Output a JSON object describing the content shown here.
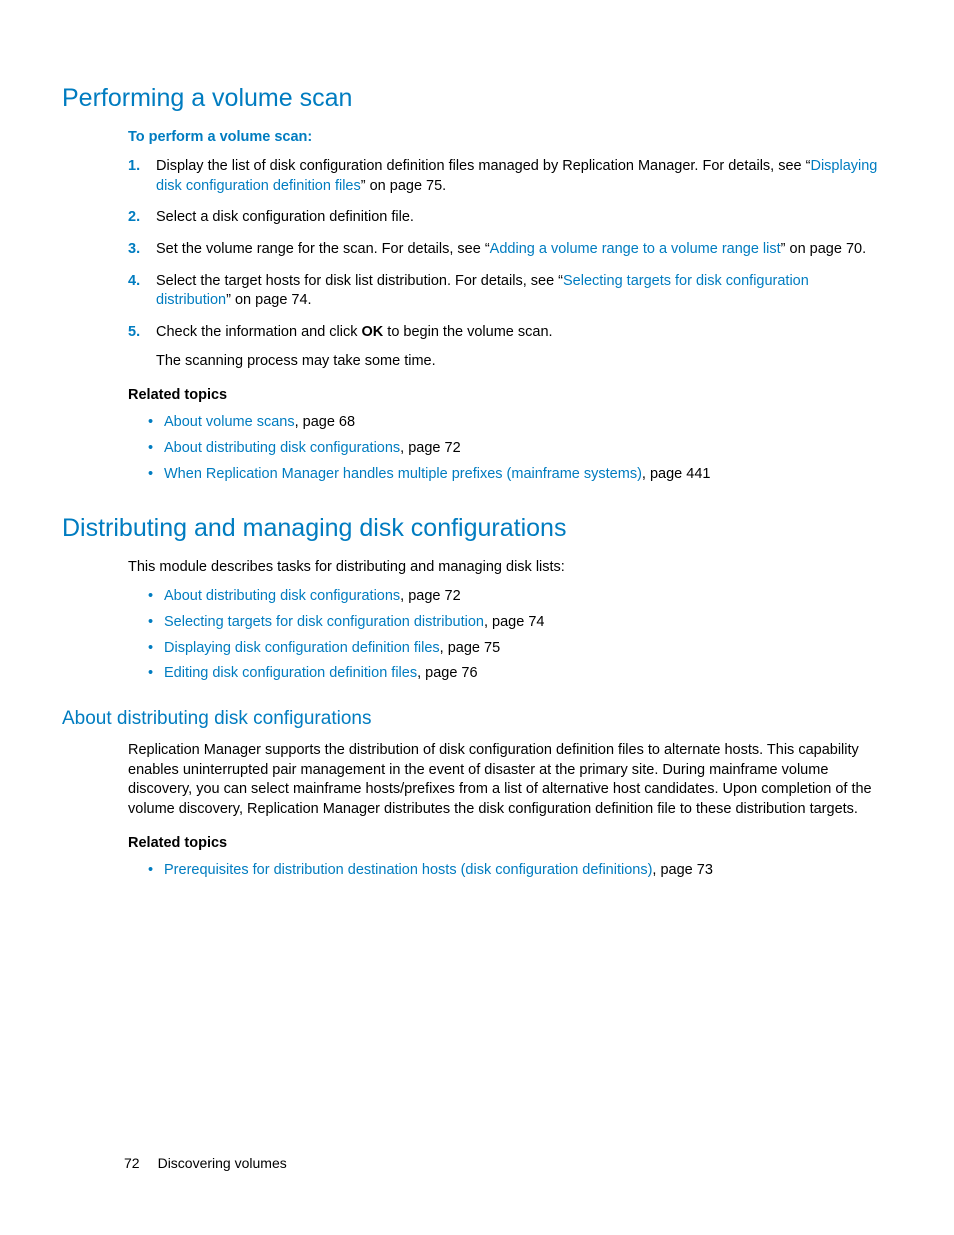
{
  "section1": {
    "title": "Performing a volume scan",
    "procedure_title": "To perform a volume scan:",
    "steps": {
      "s1a": "Display the list of disk configuration definition files managed by Replication Manager. For details, see “",
      "s1link": "Displaying disk configuration definition files",
      "s1b": "” on page 75.",
      "s2": "Select a disk configuration definition file.",
      "s3a": "Set the volume range for the scan. For details, see “",
      "s3link": "Adding a volume range to a volume range list",
      "s3b": "” on page 70.",
      "s4a": "Select the target hosts for disk list distribution. For details, see “",
      "s4link": "Selecting targets for disk configuration distribution",
      "s4b": "” on page 74.",
      "s5a": "Check the information and click ",
      "s5bold": "OK",
      "s5b": " to begin the volume scan.",
      "s5p2": "The scanning process may take some time."
    },
    "related_heading": "Related topics",
    "related": {
      "r1link": "About volume scans",
      "r1rest": ", page 68",
      "r2link": "About distributing disk configurations",
      "r2rest": ", page 72",
      "r3link": "When Replication Manager handles multiple prefixes (mainframe systems)",
      "r3rest": ", page 441"
    }
  },
  "section2": {
    "title": "Distributing and managing disk configurations",
    "intro": "This module describes tasks for distributing and managing disk lists:",
    "bullets": {
      "b1link": "About distributing disk configurations",
      "b1rest": ", page 72",
      "b2link": "Selecting targets for disk configuration distribution",
      "b2rest": ", page 74",
      "b3link": "Displaying disk configuration definition files",
      "b3rest": ", page 75",
      "b4link": "Editing disk configuration definition files",
      "b4rest": ", page 76"
    }
  },
  "section3": {
    "title": "About distributing disk configurations",
    "para": "Replication Manager supports the distribution of disk configuration definition files to alternate hosts. This capability enables uninterrupted pair management in the event of disaster at the primary site. During mainframe volume discovery, you can select mainframe hosts/prefixes from a list of alternative host candidates. Upon completion of the volume discovery, Replication Manager distributes the disk configuration definition file to these distribution targets.",
    "related_heading": "Related topics",
    "related": {
      "r1link": "Prerequisites for distribution destination hosts (disk configuration definitions)",
      "r1rest": ", page 73"
    }
  },
  "footer": {
    "page_number": "72",
    "chapter": "Discovering volumes"
  }
}
